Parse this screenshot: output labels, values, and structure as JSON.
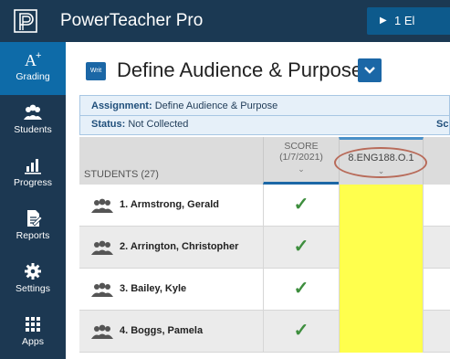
{
  "app": {
    "title": "PowerTeacher Pro",
    "top_button": "1 El",
    "play_glyph": "▶"
  },
  "sidebar": {
    "items": [
      {
        "label": "Grading",
        "icon": "grading-icon",
        "active": true
      },
      {
        "label": "Students",
        "icon": "students-icon",
        "active": false
      },
      {
        "label": "Progress",
        "icon": "progress-icon",
        "active": false
      },
      {
        "label": "Reports",
        "icon": "reports-icon",
        "active": false
      },
      {
        "label": "Settings",
        "icon": "settings-icon",
        "active": false
      },
      {
        "label": "Apps",
        "icon": "apps-icon",
        "active": false
      }
    ]
  },
  "assignment": {
    "type_badge": "Writ",
    "title": "Define Audience & Purpose",
    "info_label": "Assignment:",
    "info_value": "Define Audience & Purpose",
    "status_label": "Status:",
    "status_value": "Not Collected",
    "status_right": "Sc"
  },
  "grid": {
    "students_header": "STUDENTS (27)",
    "score_header_line1": "SCORE",
    "score_header_line2": "(1/7/2021)",
    "standard_header": "8.ENG188.O.1",
    "chevron": "⌄",
    "rows": [
      {
        "name": "1. Armstrong, Gerald",
        "score": "✓"
      },
      {
        "name": "2. Arrington, Christopher",
        "score": "✓"
      },
      {
        "name": "3. Bailey, Kyle",
        "score": "✓"
      },
      {
        "name": "4. Boggs, Pamela",
        "score": "✓"
      }
    ]
  },
  "colors": {
    "topbar": "#1b3953",
    "sidebar": "#1c3852",
    "active_nav": "#0e6ba8",
    "accent": "#1b67a6",
    "highlight": "#ffff4d",
    "check": "#3e8e3e",
    "annotation": "#b86b5a"
  }
}
